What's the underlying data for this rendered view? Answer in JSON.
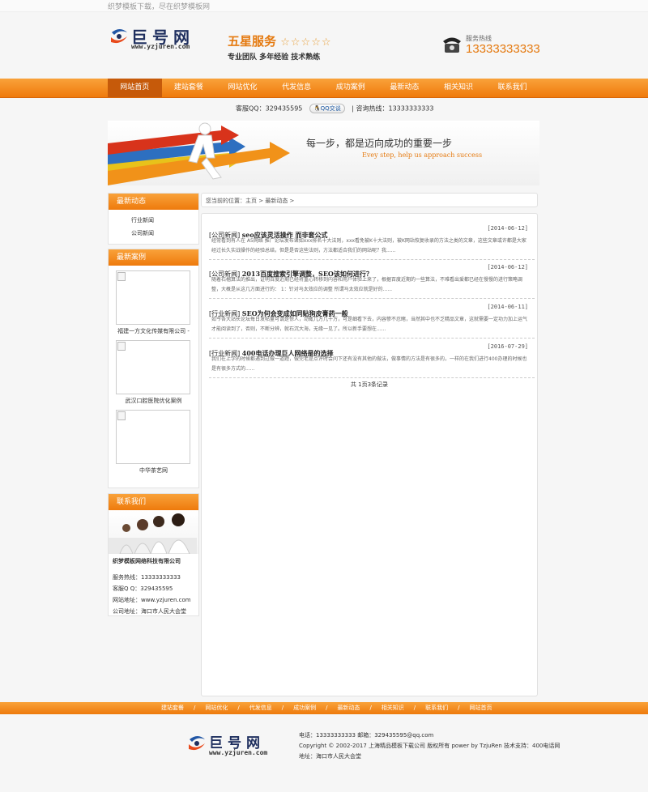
{
  "top_strip": "织梦模板下载，尽在织梦模板网",
  "header": {
    "logo_text": "巨号网",
    "logo_url": "www.yzjuren.com",
    "slogan_title": "五星服务",
    "slogan_stars": "☆☆☆☆☆",
    "slogan_sub": "专业团队 多年经验 技术熟练",
    "hotline_label": "服务热线",
    "hotline_number": "13333333333"
  },
  "nav": {
    "items": [
      "网站首页",
      "建站套餐",
      "网站优化",
      "代发信息",
      "成功案例",
      "最新动态",
      "相关知识",
      "联系我们"
    ]
  },
  "qq_bar": {
    "qq_label": "客服QQ：329435595",
    "qq_button": "QQ交谈",
    "hotline": "咨询热线：13333333333"
  },
  "banner": {
    "headline": "每一步，都是迈向成功的重要一步",
    "english": "Evey step, help us approach success"
  },
  "sidebar": {
    "news": {
      "title": "最新动态",
      "links": [
        "行业新闻",
        "公司新闻"
      ]
    },
    "cases": {
      "title": "最新案例",
      "items": [
        "福建一方文化传媒有限公司 -",
        "武汉口腔医院优化案例",
        "中华茶艺网"
      ]
    },
    "contact": {
      "title": "联系我们",
      "company": "织梦模板网络科技有限公司",
      "phone": "服务热线：13333333333",
      "qq": "客服Q Q：329435595",
      "site": "网站地址：www.yzjuren.com",
      "address": "公司地址：海口市人民大会堂"
    }
  },
  "breadcrumb": "您当前的位置：主页 > 最新动态 >",
  "articles": [
    {
      "category": "[公司新闻]",
      "title": "seo应该灵活操作 而非套公式",
      "date": "[2014-06-12]",
      "summary": "经常看到有人在 A5网络 推广论坛发布诸如xxx排名十大法则，xxx看免被K十大法则，被K网站恢复收录的方法之类的文章，这些文章或许都是大家经过长久实战操作的经验总结，但是是否这些法则，方法都适合我们的网站呢？我......"
    },
    {
      "category": "[公司新闻]",
      "title": "2013百度搜索引擎调整，SEO该如何进行？",
      "date": "[2014-06-12]",
      "summary": "随着石榴算法的推出，证明百度近期已经将重心转移到内容和用户体验上来了，根据百度近期的一些算法，不难看出爱都已经在慢慢的进行策略调整，大概是从这几方面进行的： 1：针对马太效应的调整 所谓马太效应就是好的......"
    },
    {
      "category": "[行业新闻]",
      "title": "SEO为何会变成如同贴狗皮膏药一般",
      "date": "[2014-06-11]",
      "summary": "如今各大站长论坛每日发帖量可谓是惊人，动辄几万几十万，可是细看下去，内容惨不忍睹，当然其中也不乏精品文章，这就需要一定功力加上运气才能阅读到了，否则，不断分辨，就石沉大海，无缘一见了。所以新手要想在......"
    },
    {
      "category": "[行业新闻]",
      "title": "400电话办理巨人网络是的选择",
      "date": "[2016-07-29]",
      "summary": "我们在上学的时候都遇到过做一道题，做完老是点评时会问下还有没有其他的做法，做事情的方法是有很多的，一样的在我们进行400办理的时候也是有很多方式的......"
    }
  ],
  "pager": "共 1页3条记录",
  "footer": {
    "nav": [
      "建站套餐",
      "网站优化",
      "代发信息",
      "成功案例",
      "最新动态",
      "相关知识",
      "联系我们",
      "网站首页"
    ],
    "separator": "/",
    "logo_text": "巨号网",
    "logo_url": "www.yzjuren.com",
    "line1": "电话：13333333333 邮箱：329435595@qq.com",
    "line2": "Copyright © 2002-2017 上海精品模板下载公司 版权所有 power by TzjuRen 技术支持：400电话网",
    "line3": "地址：海口市人民大会堂"
  },
  "colors": {
    "accent": "#ef7a0c",
    "nav_active": "#c65a0a",
    "logo_blue": "#1f2f5f"
  }
}
